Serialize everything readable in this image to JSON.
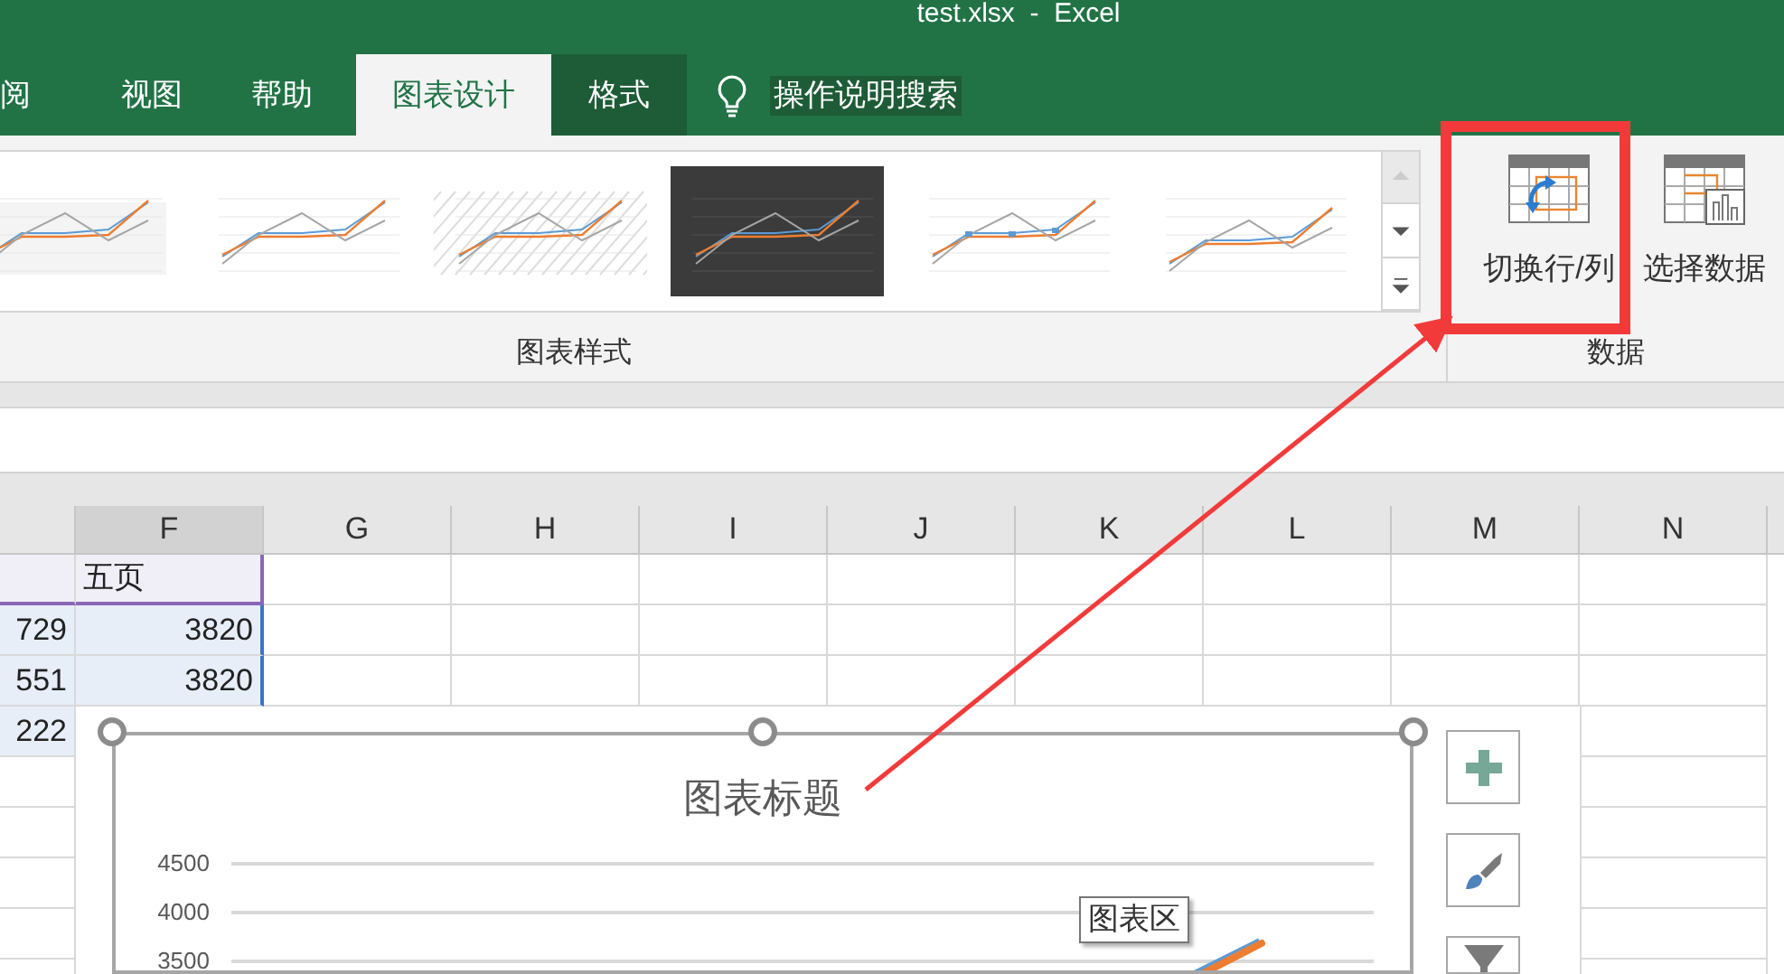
{
  "title_bar": {
    "title": "test.xlsx  -  Excel"
  },
  "tabs": [
    {
      "label": "阅",
      "selected": false,
      "kind": "normal"
    },
    {
      "label": "视图",
      "selected": false,
      "kind": "normal"
    },
    {
      "label": "帮助",
      "selected": false,
      "kind": "normal"
    },
    {
      "label": "图表设计",
      "selected": true,
      "kind": "normal"
    },
    {
      "label": "格式",
      "selected": false,
      "kind": "contextual"
    }
  ],
  "tell_me": {
    "label": "操作说明搜索"
  },
  "ribbon": {
    "chart_styles": {
      "label": "图表样式",
      "thumbnails": [
        {
          "kind": "gradient"
        },
        {
          "kind": "plain"
        },
        {
          "kind": "hatched"
        },
        {
          "kind": "dark"
        },
        {
          "kind": "markers"
        },
        {
          "kind": "legend-top"
        }
      ]
    },
    "data_group": {
      "label": "数据",
      "buttons": [
        {
          "label": "切换行/列",
          "kind": "switch"
        },
        {
          "label": "选择数据",
          "kind": "select"
        }
      ]
    }
  },
  "sheet": {
    "columns": [
      "",
      "F",
      "G",
      "H",
      "I",
      "J",
      "K",
      "L",
      "M",
      "N"
    ],
    "rows": [
      {
        "kind": "names",
        "cells": [
          "",
          "五页"
        ]
      },
      {
        "kind": "values",
        "cells": [
          "729",
          "3820"
        ]
      },
      {
        "kind": "values",
        "cells": [
          "551",
          "3820"
        ]
      },
      {
        "kind": "values",
        "cells": [
          "222",
          ""
        ]
      }
    ]
  },
  "chart": {
    "title": "图表标题",
    "y_labels": [
      "4500",
      "4000",
      "3500"
    ],
    "tooltip": "图表区"
  },
  "chart_tools": [
    {
      "kind": "add"
    },
    {
      "kind": "style"
    },
    {
      "kind": "filter"
    }
  ]
}
